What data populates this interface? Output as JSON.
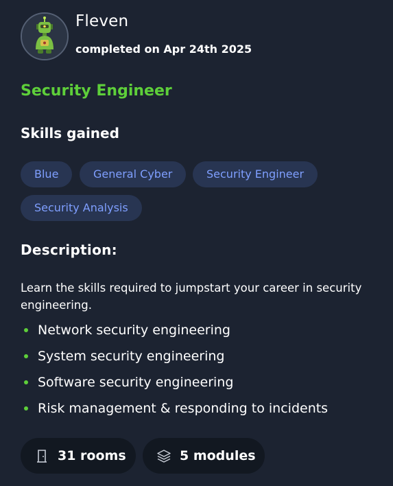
{
  "user": {
    "name": "Fleven",
    "completed": "completed on Apr 24th 2025"
  },
  "path": {
    "title": "Security Engineer"
  },
  "skills": {
    "heading": "Skills gained",
    "items": [
      "Blue",
      "General Cyber",
      "Security Engineer",
      "Security Analysis"
    ]
  },
  "description": {
    "heading": "Description:",
    "text": "Learn the skills required to jumpstart your career in security engineering.",
    "bullets": [
      "Network security engineering",
      "System security engineering",
      "Software security engineering",
      "Risk management & responding to incidents"
    ]
  },
  "stats": {
    "rooms": "31 rooms",
    "modules": "5 modules"
  },
  "colors": {
    "background": "#1c2331",
    "accent_green": "#5ecf3a",
    "chip_bg": "#283552",
    "chip_text": "#7f9fff",
    "stat_bg": "#121821"
  },
  "icons": {
    "rooms": "door-icon",
    "modules": "layers-icon"
  }
}
